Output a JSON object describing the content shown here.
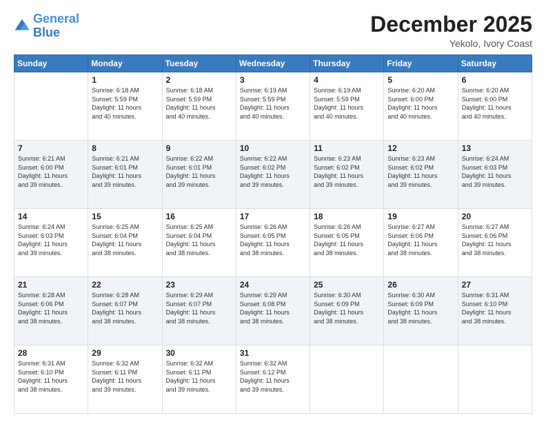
{
  "header": {
    "logo_line1": "General",
    "logo_line2": "Blue",
    "title": "December 2025",
    "subtitle": "Yekolo, Ivory Coast"
  },
  "days_of_week": [
    "Sunday",
    "Monday",
    "Tuesday",
    "Wednesday",
    "Thursday",
    "Friday",
    "Saturday"
  ],
  "weeks": [
    [
      {
        "day": "",
        "info": ""
      },
      {
        "day": "1",
        "info": "Sunrise: 6:18 AM\nSunset: 5:59 PM\nDaylight: 11 hours\nand 40 minutes."
      },
      {
        "day": "2",
        "info": "Sunrise: 6:18 AM\nSunset: 5:59 PM\nDaylight: 11 hours\nand 40 minutes."
      },
      {
        "day": "3",
        "info": "Sunrise: 6:19 AM\nSunset: 5:59 PM\nDaylight: 11 hours\nand 40 minutes."
      },
      {
        "day": "4",
        "info": "Sunrise: 6:19 AM\nSunset: 5:59 PM\nDaylight: 11 hours\nand 40 minutes."
      },
      {
        "day": "5",
        "info": "Sunrise: 6:20 AM\nSunset: 6:00 PM\nDaylight: 11 hours\nand 40 minutes."
      },
      {
        "day": "6",
        "info": "Sunrise: 6:20 AM\nSunset: 6:00 PM\nDaylight: 11 hours\nand 40 minutes."
      }
    ],
    [
      {
        "day": "7",
        "info": "Sunrise: 6:21 AM\nSunset: 6:00 PM\nDaylight: 11 hours\nand 39 minutes."
      },
      {
        "day": "8",
        "info": "Sunrise: 6:21 AM\nSunset: 6:01 PM\nDaylight: 11 hours\nand 39 minutes."
      },
      {
        "day": "9",
        "info": "Sunrise: 6:22 AM\nSunset: 6:01 PM\nDaylight: 11 hours\nand 39 minutes."
      },
      {
        "day": "10",
        "info": "Sunrise: 6:22 AM\nSunset: 6:02 PM\nDaylight: 11 hours\nand 39 minutes."
      },
      {
        "day": "11",
        "info": "Sunrise: 6:23 AM\nSunset: 6:02 PM\nDaylight: 11 hours\nand 39 minutes."
      },
      {
        "day": "12",
        "info": "Sunrise: 6:23 AM\nSunset: 6:02 PM\nDaylight: 11 hours\nand 39 minutes."
      },
      {
        "day": "13",
        "info": "Sunrise: 6:24 AM\nSunset: 6:03 PM\nDaylight: 11 hours\nand 39 minutes."
      }
    ],
    [
      {
        "day": "14",
        "info": "Sunrise: 6:24 AM\nSunset: 6:03 PM\nDaylight: 11 hours\nand 39 minutes."
      },
      {
        "day": "15",
        "info": "Sunrise: 6:25 AM\nSunset: 6:04 PM\nDaylight: 11 hours\nand 38 minutes."
      },
      {
        "day": "16",
        "info": "Sunrise: 6:25 AM\nSunset: 6:04 PM\nDaylight: 11 hours\nand 38 minutes."
      },
      {
        "day": "17",
        "info": "Sunrise: 6:26 AM\nSunset: 6:05 PM\nDaylight: 11 hours\nand 38 minutes."
      },
      {
        "day": "18",
        "info": "Sunrise: 6:26 AM\nSunset: 6:05 PM\nDaylight: 11 hours\nand 38 minutes."
      },
      {
        "day": "19",
        "info": "Sunrise: 6:27 AM\nSunset: 6:06 PM\nDaylight: 11 hours\nand 38 minutes."
      },
      {
        "day": "20",
        "info": "Sunrise: 6:27 AM\nSunset: 6:06 PM\nDaylight: 11 hours\nand 38 minutes."
      }
    ],
    [
      {
        "day": "21",
        "info": "Sunrise: 6:28 AM\nSunset: 6:06 PM\nDaylight: 11 hours\nand 38 minutes."
      },
      {
        "day": "22",
        "info": "Sunrise: 6:28 AM\nSunset: 6:07 PM\nDaylight: 11 hours\nand 38 minutes."
      },
      {
        "day": "23",
        "info": "Sunrise: 6:29 AM\nSunset: 6:07 PM\nDaylight: 11 hours\nand 38 minutes."
      },
      {
        "day": "24",
        "info": "Sunrise: 6:29 AM\nSunset: 6:08 PM\nDaylight: 11 hours\nand 38 minutes."
      },
      {
        "day": "25",
        "info": "Sunrise: 6:30 AM\nSunset: 6:09 PM\nDaylight: 11 hours\nand 38 minutes."
      },
      {
        "day": "26",
        "info": "Sunrise: 6:30 AM\nSunset: 6:09 PM\nDaylight: 11 hours\nand 38 minutes."
      },
      {
        "day": "27",
        "info": "Sunrise: 6:31 AM\nSunset: 6:10 PM\nDaylight: 11 hours\nand 38 minutes."
      }
    ],
    [
      {
        "day": "28",
        "info": "Sunrise: 6:31 AM\nSunset: 6:10 PM\nDaylight: 11 hours\nand 38 minutes."
      },
      {
        "day": "29",
        "info": "Sunrise: 6:32 AM\nSunset: 6:11 PM\nDaylight: 11 hours\nand 39 minutes."
      },
      {
        "day": "30",
        "info": "Sunrise: 6:32 AM\nSunset: 6:11 PM\nDaylight: 11 hours\nand 39 minutes."
      },
      {
        "day": "31",
        "info": "Sunrise: 6:32 AM\nSunset: 6:12 PM\nDaylight: 11 hours\nand 39 minutes."
      },
      {
        "day": "",
        "info": ""
      },
      {
        "day": "",
        "info": ""
      },
      {
        "day": "",
        "info": ""
      }
    ]
  ]
}
